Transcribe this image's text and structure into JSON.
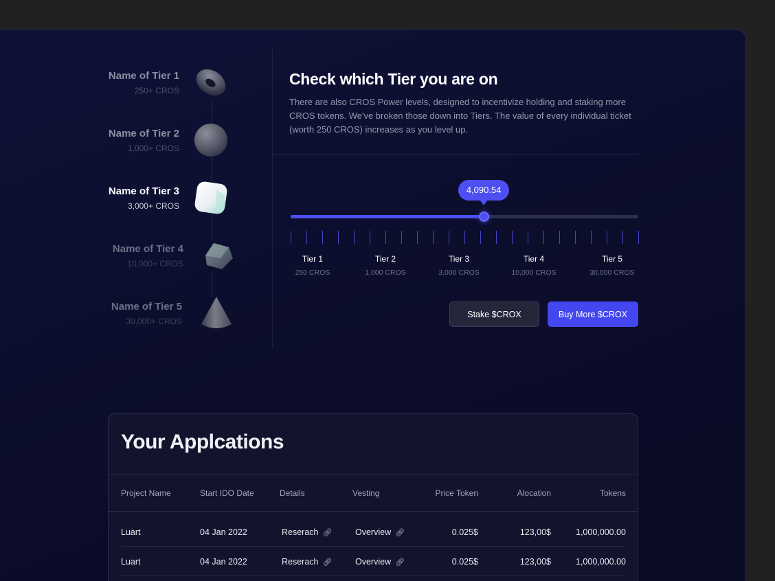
{
  "tiers": [
    {
      "name": "Name of Tier 1",
      "requirement": "250+ CROS",
      "icon": "torus-icon"
    },
    {
      "name": "Name of Tier 2",
      "requirement": "1,000+ CROS",
      "icon": "sphere-icon"
    },
    {
      "name": "Name of Tier 3",
      "requirement": "3,000+ CROS",
      "icon": "cube-icon"
    },
    {
      "name": "Name of Tier 4",
      "requirement": "10,000+ CROS",
      "icon": "prism-icon"
    },
    {
      "name": "Name of Tier 5",
      "requirement": "30,000+ CROS",
      "icon": "cone-icon"
    }
  ],
  "active_tier_index": 2,
  "header": {
    "title": "Check which Tier you are on",
    "description": "There are also CROS Power levels, designed to incentivize holding and staking more CROS tokens. We've broken those down into Tiers. The value of every individual ticket (worth 250 CROS) increases as you level up."
  },
  "slider": {
    "value_label": "4,090.54",
    "progress_fraction": 0.556,
    "milestones": [
      {
        "label": "Tier 1",
        "value": "250 CROS"
      },
      {
        "label": "Tier 2",
        "value": "1,000 CROS"
      },
      {
        "label": "Tier 3",
        "value": "3,000 CROS"
      },
      {
        "label": "Tier 4",
        "value": "10,000 CROS"
      },
      {
        "label": "Tier 5",
        "value": "30,000 CROS"
      }
    ]
  },
  "buttons": {
    "stake": "Stake $CROX",
    "buy": "Buy More $CROX"
  },
  "applications": {
    "title": "Your Applcations",
    "columns": [
      "Project Name",
      "Start IDO Date",
      "Details",
      "Vesting",
      "Price Token",
      "Alocation",
      "Tokens"
    ],
    "rows": [
      {
        "project": "Luart",
        "date": "04 Jan 2022",
        "details": "Reserach",
        "vesting": "Overview",
        "price": "0.025$",
        "allocation": "123,00$",
        "tokens": "1,000,000.00"
      },
      {
        "project": "Luart",
        "date": "04 Jan 2022",
        "details": "Reserach",
        "vesting": "Overview",
        "price": "0.025$",
        "allocation": "123,00$",
        "tokens": "1,000,000.00"
      }
    ]
  },
  "colors": {
    "accent": "#4d4ff2",
    "background": "#0d0f2e",
    "frame": "#212121"
  }
}
